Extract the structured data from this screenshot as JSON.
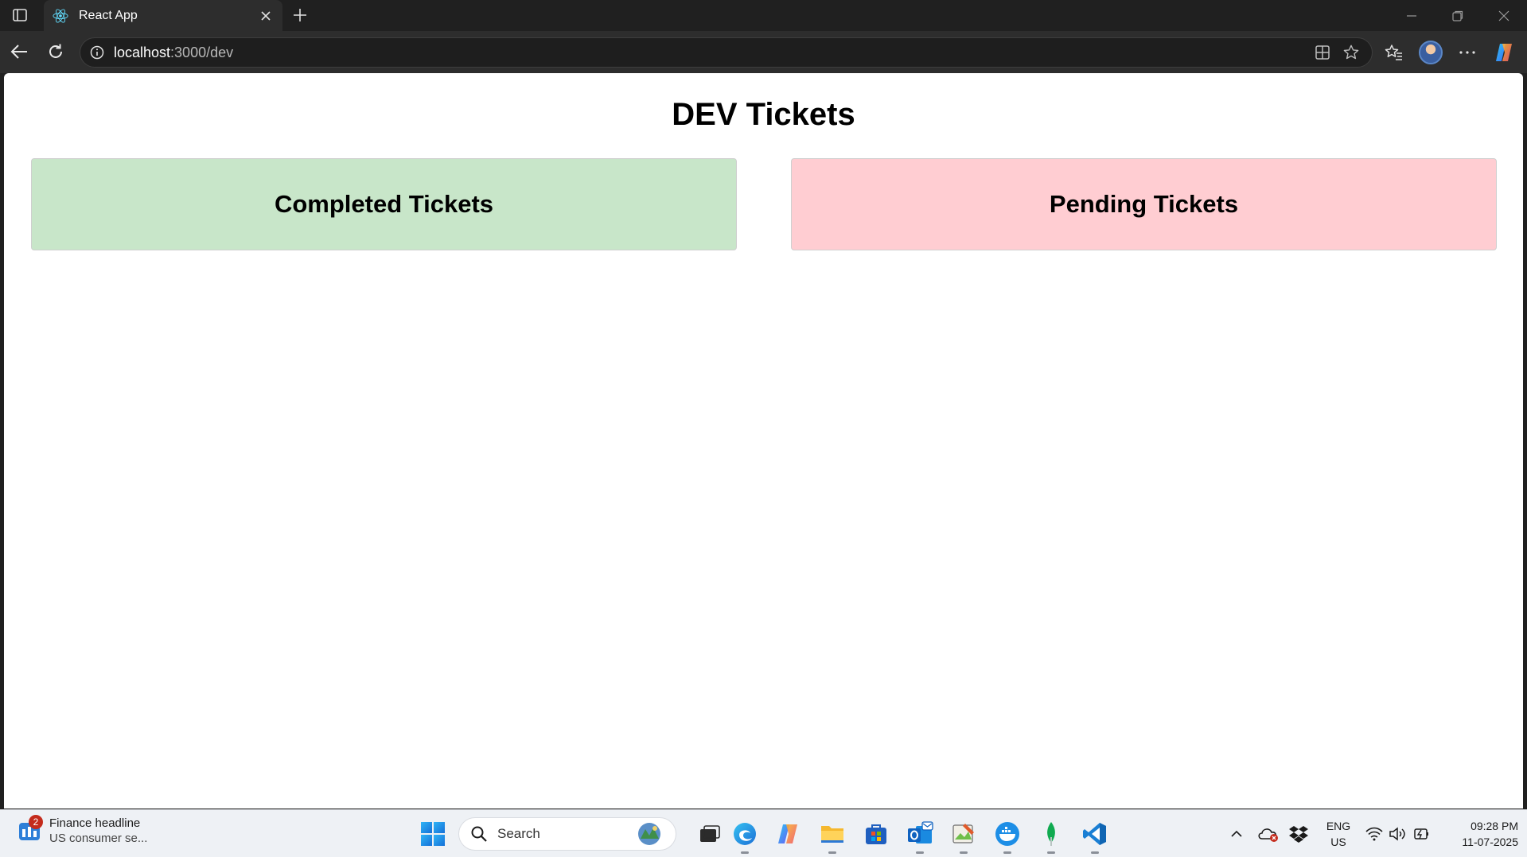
{
  "browser": {
    "tab_title": "React App",
    "address_host": "localhost",
    "address_path": ":3000/dev"
  },
  "page": {
    "title": "DEV Tickets",
    "completed_label": "Completed Tickets",
    "pending_label": "Pending Tickets",
    "colors": {
      "completed_bg": "#c8e6c9",
      "pending_bg": "#ffcdd2"
    }
  },
  "taskbar": {
    "widget_badge": "2",
    "widget_title": "Finance headline",
    "widget_subtitle": "US consumer se...",
    "search_label": "Search",
    "lang_primary": "ENG",
    "lang_secondary": "US",
    "time": "09:28 PM",
    "date": "11-07-2025"
  }
}
